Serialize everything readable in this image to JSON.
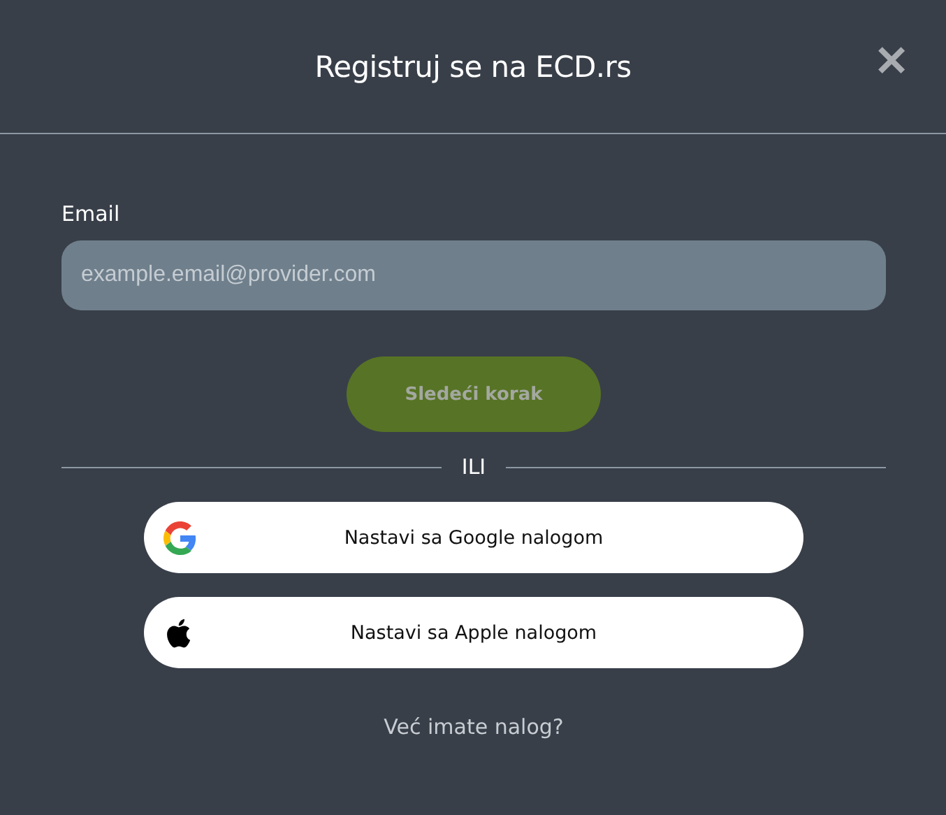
{
  "dialog": {
    "title": "Registruj se na ECD.rs",
    "close_label": "✕"
  },
  "email": {
    "label": "Email",
    "placeholder": "example.email@provider.com"
  },
  "next_button": {
    "label": "Sledeći korak",
    "disabled": true
  },
  "separator": "ILI",
  "social_buttons": [
    {
      "kind": "google",
      "label": "Nastavi sa Google nalogom"
    },
    {
      "kind": "apple",
      "label": "Nastavi sa Apple nalogom"
    }
  ],
  "login_link": "Već imate nalog?"
}
